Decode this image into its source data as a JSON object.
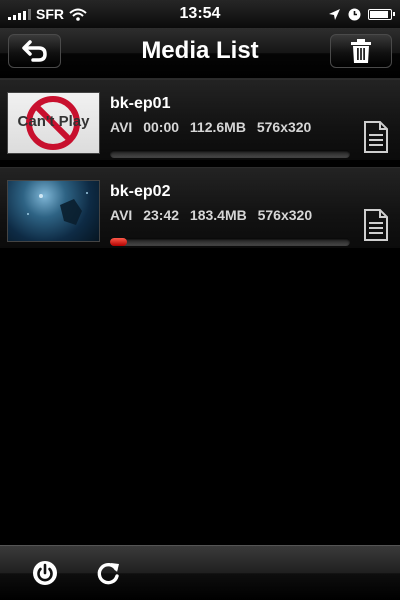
{
  "status_bar": {
    "carrier": "SFR",
    "time": "13:54",
    "icons": [
      "signal-icon",
      "wifi-icon",
      "location-icon",
      "alarm-clock-icon",
      "battery-icon"
    ]
  },
  "nav": {
    "title": "Media List",
    "back_icon": "back-arrow-icon",
    "trash_icon": "trash-icon"
  },
  "media_list": [
    {
      "title": "bk-ep01",
      "format": "AVI",
      "duration": "00:00",
      "size": "112.6MB",
      "resolution": "576x320",
      "thumbnail_text": "Can't Play",
      "progress": 0.0
    },
    {
      "title": "bk-ep02",
      "format": "AVI",
      "duration": "23:42",
      "size": "183.4MB",
      "resolution": "576x320",
      "thumbnail_text": "",
      "progress": 0.07
    }
  ],
  "toolbar": {
    "icons": [
      "power-icon",
      "refresh-icon"
    ]
  },
  "colors": {
    "progress_fill": "#d01a10",
    "no_play_red": "#c8102e"
  }
}
